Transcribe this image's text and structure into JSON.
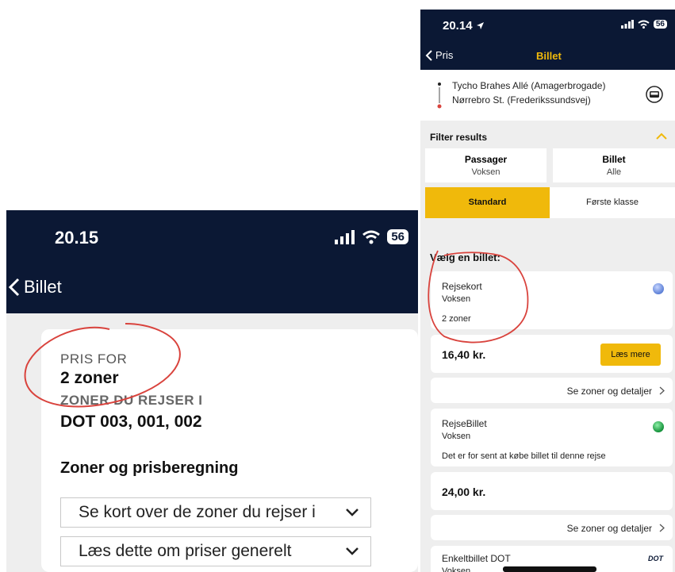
{
  "left": {
    "status": {
      "time": "20.15",
      "battery": "56"
    },
    "nav": {
      "back_label": "Billet"
    },
    "card": {
      "price_for_label": "PRIS FOR",
      "price_for_value": "2 zoner",
      "zones_label": "ZONER DU REJSER I",
      "zones_value": "DOT 003, 001, 002",
      "section_title": "Zoner og prisberegning",
      "accordion": [
        {
          "label": "Se kort over de zoner du rejser i"
        },
        {
          "label": "Læs dette om priser generelt"
        }
      ]
    }
  },
  "right": {
    "status": {
      "time": "20.14",
      "battery": "56"
    },
    "nav": {
      "back_label": "Pris",
      "title": "Billet"
    },
    "route": {
      "from": "Tycho Brahes Allé (Amagerbrogade)",
      "to": "Nørrebro St. (Frederikssundsvej)"
    },
    "filter": {
      "title": "Filter results",
      "passenger_label": "Passager",
      "passenger_value": "Voksen",
      "ticket_label": "Billet",
      "ticket_value": "Alle",
      "class_options": [
        "Standard",
        "Første klasse"
      ]
    },
    "choose_label": "Vælg en billet:",
    "tickets": [
      {
        "name": "Rejsekort",
        "type": "Voksen",
        "info": "2 zoner",
        "price": "16,40 kr.",
        "button": "Læs mere",
        "link": "Se zoner og detaljer",
        "dot_color": "#5c7fd6"
      },
      {
        "name": "RejseBillet",
        "type": "Voksen",
        "info": "Det er for sent at købe billet til denne rejse",
        "price": "24,00 kr.",
        "link": "Se zoner og detaljer",
        "dot_color": "#14913a"
      },
      {
        "name": "Enkeltbillet DOT",
        "type": "Voksen",
        "badge": "DOT"
      }
    ]
  },
  "colors": {
    "navy": "#0b1834",
    "accent": "#f0b90b",
    "annotation": "#d9433d"
  }
}
